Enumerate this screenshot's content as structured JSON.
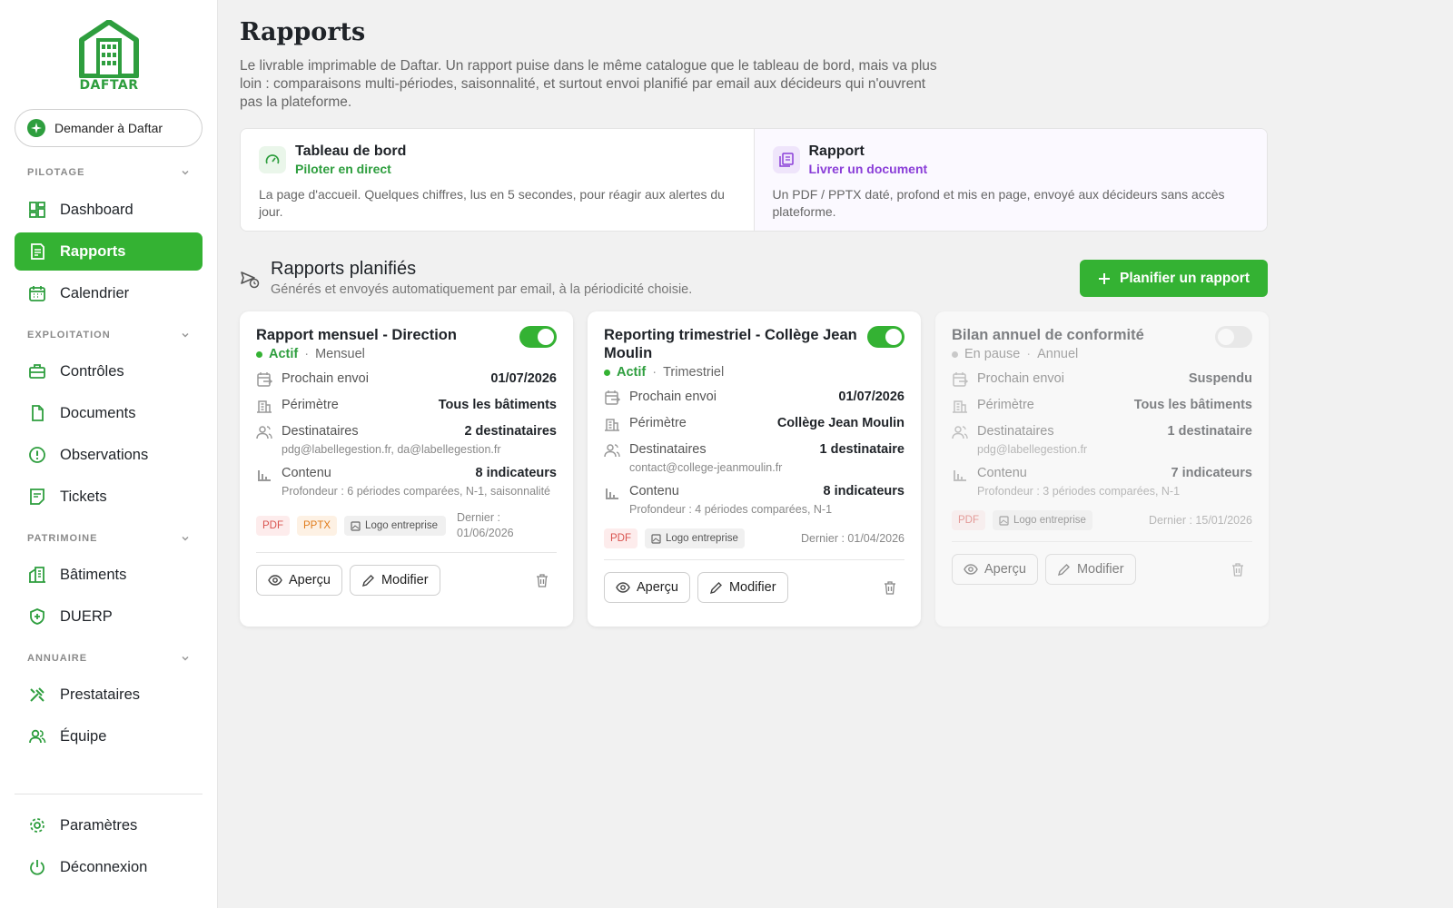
{
  "app": {
    "logo_text": "DAFTAR",
    "ask_label": "Demander à Daftar"
  },
  "sidebar": {
    "sections": [
      {
        "label": "PILOTAGE",
        "items": [
          {
            "label": "Dashboard"
          },
          {
            "label": "Rapports"
          },
          {
            "label": "Calendrier"
          }
        ]
      },
      {
        "label": "EXPLOITATION",
        "items": [
          {
            "label": "Contrôles"
          },
          {
            "label": "Documents"
          },
          {
            "label": "Observations"
          },
          {
            "label": "Tickets"
          }
        ]
      },
      {
        "label": "PATRIMOINE",
        "items": [
          {
            "label": "Bâtiments"
          },
          {
            "label": "DUERP"
          }
        ]
      },
      {
        "label": "ANNUAIRE",
        "items": [
          {
            "label": "Prestataires"
          },
          {
            "label": "Équipe"
          }
        ]
      }
    ],
    "bottom": [
      {
        "label": "Paramètres"
      },
      {
        "label": "Déconnexion"
      }
    ],
    "active": "Rapports"
  },
  "page": {
    "title": "Rapports",
    "lead": "Le livrable imprimable de Daftar. Un rapport puise dans le même catalogue que le tableau de bord, mais va plus loin : comparaisons multi-périodes, saisonnalité, et surtout envoi planifié par email aux décideurs qui n'ouvrent pas la plateforme."
  },
  "compare": {
    "left": {
      "title": "Tableau de bord",
      "subtitle": "Piloter en direct",
      "desc": "La page d'accueil. Quelques chiffres, lus en 5 secondes, pour réagir aux alertes du jour."
    },
    "right": {
      "title": "Rapport",
      "subtitle": "Livrer un document",
      "desc": "Un PDF / PPTX daté, profond et mis en page, envoyé aux décideurs sans accès plateforme."
    }
  },
  "scheduled": {
    "title": "Rapports planifiés",
    "subtitle": "Générés et envoyés automatiquement par email, à la périodicité choisie.",
    "plan_button": "Planifier un rapport"
  },
  "labels": {
    "next_send": "Prochain envoi",
    "scope": "Périmètre",
    "recipients": "Destinataires",
    "content": "Contenu",
    "preview": "Aperçu",
    "edit": "Modifier"
  },
  "cards": [
    {
      "title": "Rapport mensuel - Direction",
      "enabled": true,
      "status": "Actif",
      "period": "Mensuel",
      "next_send": "01/07/2026",
      "scope": "Tous les bâtiments",
      "recipients": "2 destinataires",
      "emails": "pdg@labellegestion.fr, da@labellegestion.fr",
      "content": "8 indicateurs",
      "depth": "Profondeur : 6 périodes comparées, N-1, saisonnalité",
      "formats": [
        "PDF",
        "PPTX"
      ],
      "logo": "Logo entreprise",
      "last": "Dernier : 01/06/2026"
    },
    {
      "title": "Reporting trimestriel - Collège Jean Moulin",
      "enabled": true,
      "status": "Actif",
      "period": "Trimestriel",
      "next_send": "01/07/2026",
      "scope": "Collège Jean Moulin",
      "recipients": "1 destinataire",
      "emails": "contact@college-jeanmoulin.fr",
      "content": "8 indicateurs",
      "depth": "Profondeur : 4 périodes comparées, N-1",
      "formats": [
        "PDF"
      ],
      "logo": "Logo entreprise",
      "last": "Dernier : 01/04/2026"
    },
    {
      "title": "Bilan annuel de conformité",
      "enabled": false,
      "status": "En pause",
      "period": "Annuel",
      "next_send": "Suspendu",
      "scope": "Tous les bâtiments",
      "recipients": "1 destinataire",
      "emails": "pdg@labellegestion.fr",
      "content": "7 indicateurs",
      "depth": "Profondeur : 3 périodes comparées, N-1",
      "formats": [
        "PDF"
      ],
      "logo": "Logo entreprise",
      "last": "Dernier : 15/01/2026"
    }
  ],
  "colors": {
    "brand": "#34b233",
    "brand_dark": "#2e9e3e",
    "purple": "#8a3ed8",
    "pdf": "#d9534f",
    "pptx": "#e07b1a"
  }
}
